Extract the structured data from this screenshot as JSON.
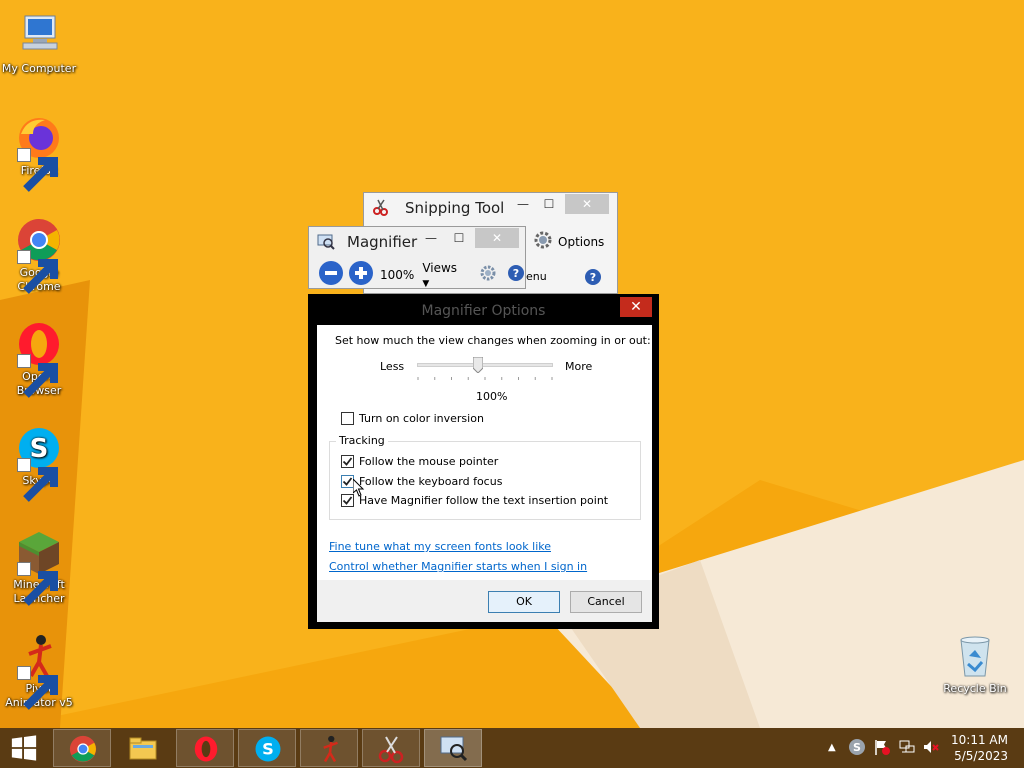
{
  "desktop": {
    "icons": [
      {
        "label": "My Computer",
        "icon": "computer-icon"
      },
      {
        "label": "Firefox",
        "icon": "firefox-icon"
      },
      {
        "label": "Google Chrome",
        "icon": "chrome-icon"
      },
      {
        "label": "Opera Browser",
        "icon": "opera-icon"
      },
      {
        "label": "Skype",
        "icon": "skype-icon"
      },
      {
        "label": "Minecraft Launcher",
        "icon": "minecraft-icon"
      },
      {
        "label": "Pivot Animator v5",
        "icon": "pivot-icon"
      },
      {
        "label": "Recycle Bin",
        "icon": "recycle-bin-icon"
      }
    ]
  },
  "snipping_tool": {
    "title": "Snipping Tool",
    "options_label": "Options",
    "menu_label": "enu"
  },
  "magnifier": {
    "title": "Magnifier",
    "zoom": "100%",
    "views_label": "Views"
  },
  "magnifier_options": {
    "title": "Magnifier Options",
    "zoom_prompt": "Set how much the view changes when zooming in or out:",
    "less_label": "Less",
    "more_label": "More",
    "zoom_increment": "100%",
    "zoom_slider_level": 0.45,
    "color_inversion": {
      "label": "Turn on color inversion",
      "checked": false
    },
    "tracking": {
      "legend": "Tracking",
      "follow_mouse": {
        "label": "Follow the mouse pointer",
        "checked": true
      },
      "follow_keyboard": {
        "label": "Follow the keyboard focus",
        "checked": true
      },
      "follow_text": {
        "label": "Have Magnifier follow the text insertion point",
        "checked": true
      }
    },
    "link_fonts": "Fine tune what my screen fonts look like",
    "link_signin": "Control whether Magnifier starts when I sign in",
    "ok_label": "OK",
    "cancel_label": "Cancel"
  },
  "taskbar": {
    "clock_time": "10:11 AM",
    "clock_date": "5/5/2023"
  },
  "colors": {
    "wallpaper": "#f6a70e",
    "taskbar": "#5a3b13",
    "close_red": "#c42b1c",
    "link": "#0066cc"
  }
}
